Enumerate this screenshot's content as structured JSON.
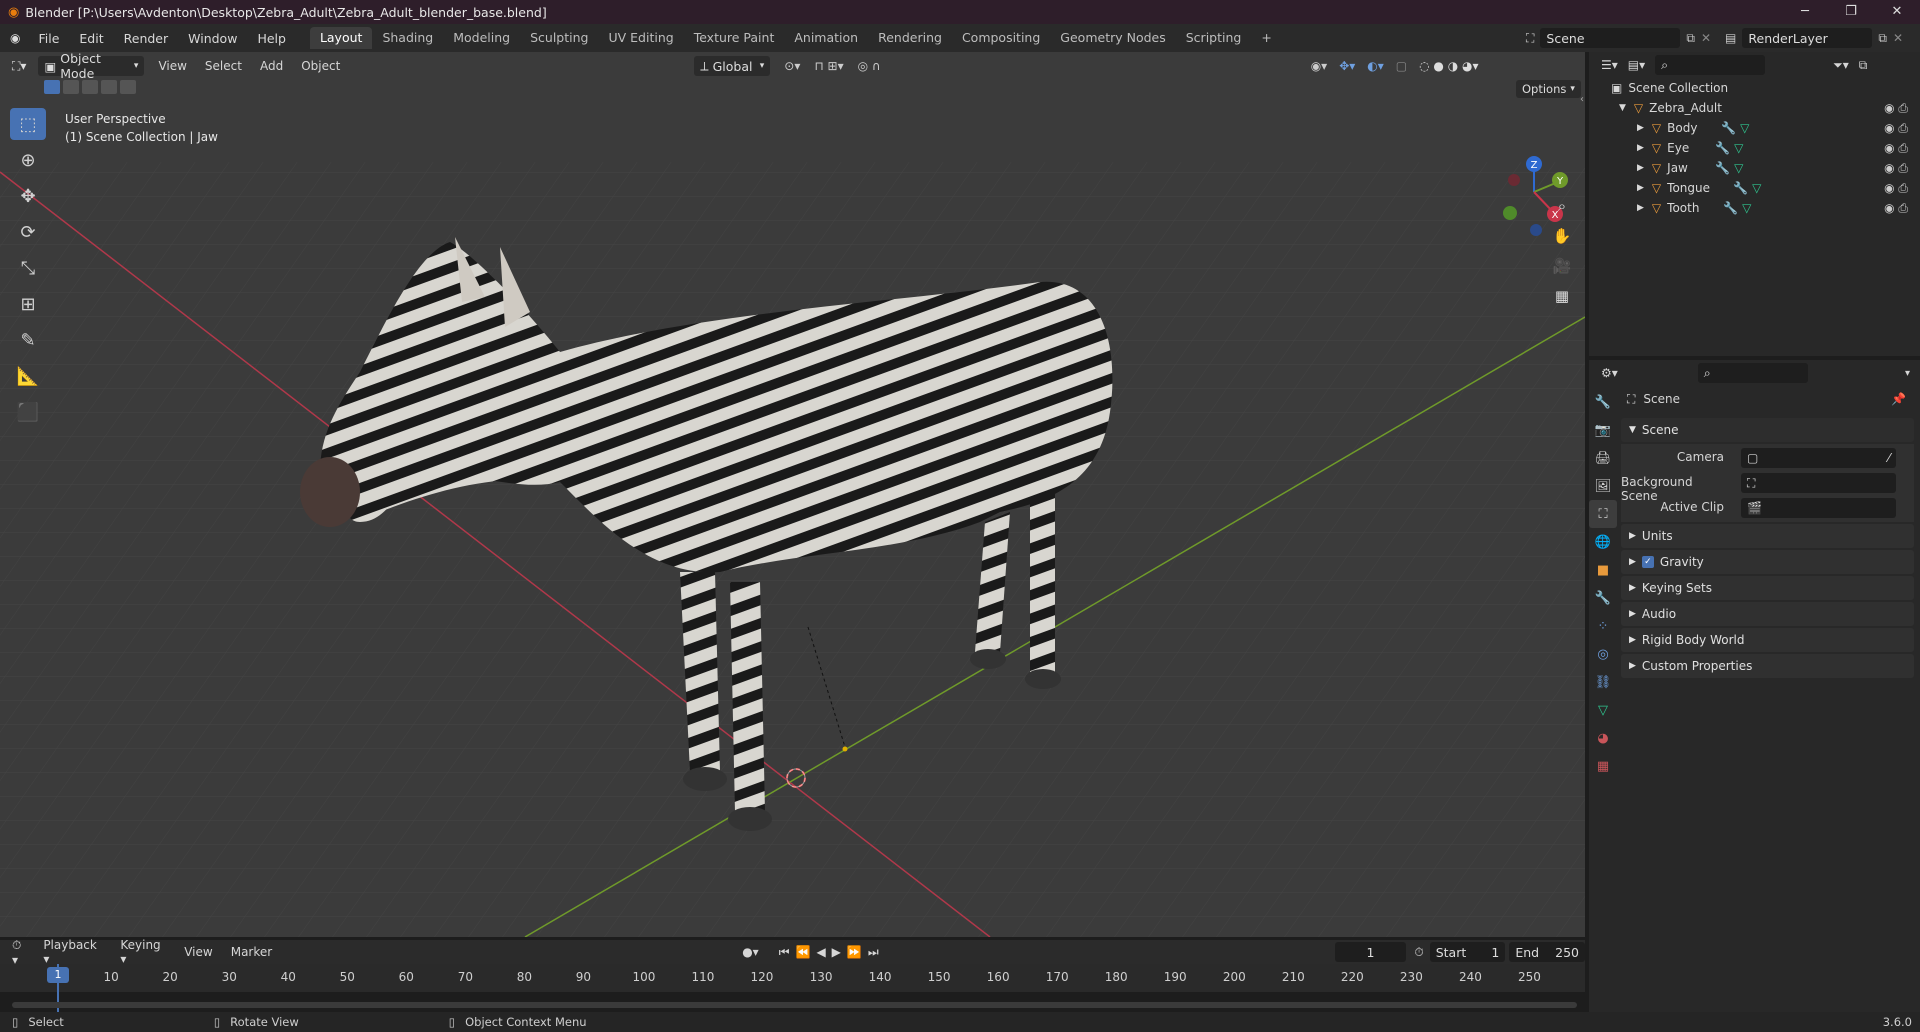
{
  "window": {
    "title": "Blender [P:\\Users\\Avdenton\\Desktop\\Zebra_Adult\\Zebra_Adult_blender_base.blend]"
  },
  "menu": [
    "File",
    "Edit",
    "Render",
    "Window",
    "Help"
  ],
  "workspaces": [
    "Layout",
    "Shading",
    "Modeling",
    "Sculpting",
    "UV Editing",
    "Texture Paint",
    "Animation",
    "Rendering",
    "Compositing",
    "Geometry Nodes",
    "Scripting"
  ],
  "active_workspace": "Layout",
  "scene_name": "Scene",
  "render_layer": "RenderLayer",
  "viewport": {
    "mode": "Object Mode",
    "menus": [
      "View",
      "Select",
      "Add",
      "Object"
    ],
    "orientation": "Global",
    "options_label": "Options",
    "overlay_line1": "User Perspective",
    "overlay_line2": "(1) Scene Collection | Jaw"
  },
  "outliner": {
    "root": "Scene Collection",
    "collection": "Zebra_Adult",
    "items": [
      {
        "name": "Body"
      },
      {
        "name": "Eye"
      },
      {
        "name": "Jaw"
      },
      {
        "name": "Tongue"
      },
      {
        "name": "Tooth"
      }
    ]
  },
  "properties": {
    "context": "Scene",
    "section": "Scene",
    "fields": {
      "camera": "Camera",
      "background_scene": "Background Scene",
      "active_clip": "Active Clip"
    },
    "panels": [
      "Units",
      "Gravity",
      "Keying Sets",
      "Audio",
      "Rigid Body World",
      "Custom Properties"
    ]
  },
  "timeline": {
    "menus": [
      "Playback",
      "Keying",
      "View",
      "Marker"
    ],
    "current_frame": "1",
    "start_label": "Start",
    "start": "1",
    "end_label": "End",
    "end": "250",
    "ticks": [
      "1",
      "10",
      "20",
      "30",
      "40",
      "50",
      "60",
      "70",
      "80",
      "90",
      "100",
      "110",
      "120",
      "130",
      "140",
      "150",
      "160",
      "170",
      "180",
      "190",
      "200",
      "210",
      "220",
      "230",
      "240",
      "250"
    ]
  },
  "statusbar": {
    "select": "Select",
    "rotate": "Rotate View",
    "context": "Object Context Menu",
    "version": "3.6.0"
  },
  "colors": {
    "accent": "#4772b3",
    "x_axis": "#b0384a",
    "y_axis": "#6f9a2a",
    "title_bg": "#2e1e2a"
  }
}
